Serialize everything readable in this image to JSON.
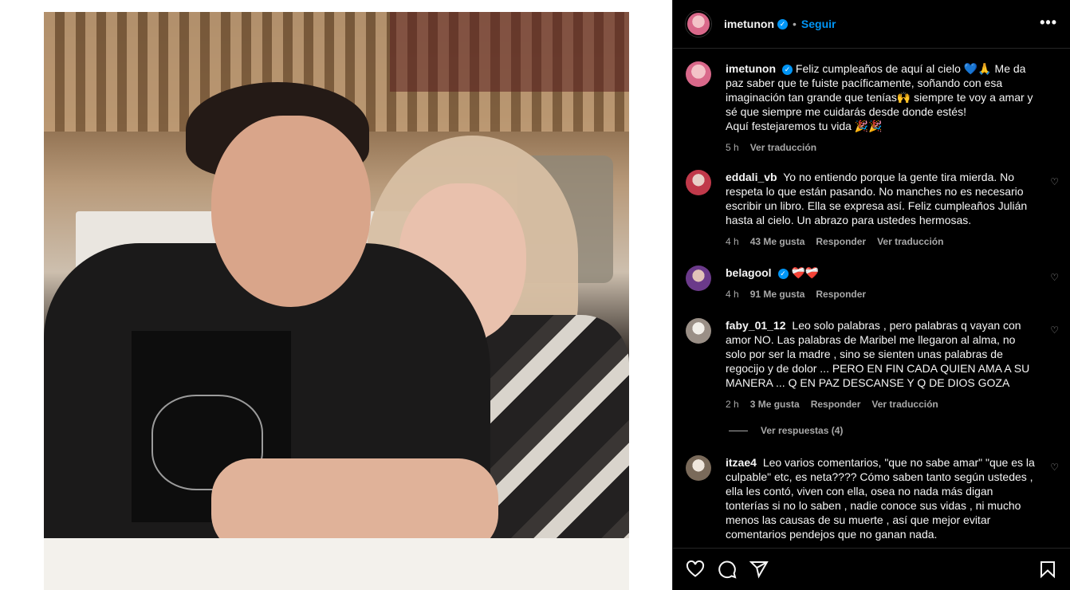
{
  "post": {
    "username": "imetunon",
    "follow_label": "Seguir",
    "more_label": "•••",
    "image_alt": "Foto de pareja sentada en un restaurante"
  },
  "caption": {
    "username": "imetunon",
    "text": "Feliz cumpleaños de aquí al cielo 💙🙏 Me da paz saber que te fuiste pacíficamente, soñando con esa imaginación tan grande que tenías🙌 siempre te voy a amar y sé que siempre me cuidarás desde donde estés!",
    "text2": "Aquí festejaremos tu vida 🎉🎉",
    "time": "5 h",
    "translate": "Ver traducción"
  },
  "comments": [
    {
      "username": "eddali_vb",
      "text": "Yo no entiendo porque la gente tira mierda. No respeta lo que están pasando. No manches no es necesario escribir un libro. Ella se expresa así. Feliz cumpleaños Julián hasta al cielo. Un abrazo para ustedes hermosas.",
      "time": "4 h",
      "likes": "43 Me gusta",
      "reply": "Responder",
      "translate": "Ver traducción",
      "avatar_color": "#c0394a"
    },
    {
      "username": "belagool",
      "text": "❤️‍🩹❤️‍🩹",
      "time": "4 h",
      "likes": "91 Me gusta",
      "reply": "Responder",
      "translate": "",
      "avatar_color": "#6b3a8a"
    },
    {
      "username": "faby_01_12",
      "text": "Leo solo palabras , pero palabras q vayan con amor NO. Las palabras de Maribel me llegaron al alma, no solo por ser la madre , sino se sienten unas palabras de regocijo y de dolor ... PERO EN FIN CADA QUIEN AMA A SU MANERA ... Q EN PAZ DESCANSE Y Q DE DIOS GOZA",
      "time": "2 h",
      "likes": "3 Me gusta",
      "reply": "Responder",
      "translate": "Ver traducción",
      "avatar_color": "#9a8f86"
    },
    {
      "username": "itzae4",
      "text": "Leo varios comentarios, \"que no sabe amar\" \"que es la culpable\" etc, es neta???? Cómo saben tanto según ustedes , ella les contó, viven con ella, osea no nada más digan tonterías si no lo saben , nadie conoce sus vidas , ni mucho menos las causas de su muerte , así que mejor evitar comentarios pendejos que no ganan nada.",
      "time": "",
      "likes": "",
      "reply": "",
      "translate": "",
      "avatar_color": "#7a6a5a"
    }
  ],
  "view_replies": "Ver respuestas (4)",
  "icons": [
    "heart-icon",
    "comment-icon",
    "share-icon",
    "bookmark-icon"
  ]
}
